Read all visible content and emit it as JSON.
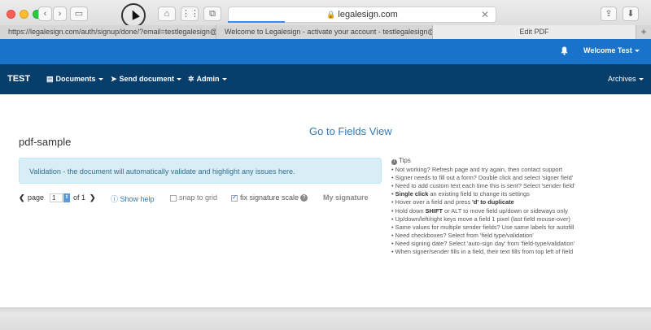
{
  "browser": {
    "url": "legalesign.com",
    "tabs": [
      {
        "label": "https://legalesign.com/auth/signup/done/?email=testlegalesign@gmail.com"
      },
      {
        "label": "Welcome to Legalesign - activate your account - testlegalesign@gma..."
      },
      {
        "label": "Edit PDF"
      }
    ],
    "new_tab": "+"
  },
  "topbar": {
    "welcome": "Welcome Test"
  },
  "nav": {
    "brand": "TEST",
    "documents": "Documents",
    "send_document": "Send document",
    "admin": "Admin",
    "archives": "Archives"
  },
  "main": {
    "fields_link": "Go to Fields View",
    "doc_title": "pdf-sample",
    "validation": "Validation - the document will automatically validate and highlight any issues here.",
    "page_label": "page",
    "page_value": "1",
    "of_label": "of 1",
    "show_help": "Show help",
    "snap_to_grid": "snap to grid",
    "fix_signature_scale": "fix signature scale",
    "my_signature": "My signature"
  },
  "tips": {
    "title": "Tips",
    "items": [
      {
        "pre": "• Not working? Refresh page and try again, then contact support",
        "bold": "",
        "post": ""
      },
      {
        "pre": "• Signer needs to fill out a form? Double click and select 'signer field'",
        "bold": "",
        "post": ""
      },
      {
        "pre": "• Need to add custom text each time this is sent? Select 'sender field'",
        "bold": "",
        "post": ""
      },
      {
        "pre": "• ",
        "bold": "Single click",
        "post": " an existing field to change its settings"
      },
      {
        "pre": "• Hover over a field and press ",
        "bold": "'d' to duplicate",
        "post": ""
      },
      {
        "pre": "• Hold down ",
        "bold": "SHIFT",
        "post": " or ALT to move field up/down or sideways only"
      },
      {
        "pre": "• Up/down/left/right keys move a field 1 pixel (last field mouse-over)",
        "bold": "",
        "post": ""
      },
      {
        "pre": "• Same values for multiple sender fields? Use same labels for autofill",
        "bold": "",
        "post": ""
      },
      {
        "pre": "• Need checkboxes? Select from 'field type/validation'",
        "bold": "",
        "post": ""
      },
      {
        "pre": "• Need signing date? Select 'auto-sign day' from 'field-type/validation'",
        "bold": "",
        "post": ""
      },
      {
        "pre": "• When signer/sender fills in a field, their text fills from top left of field",
        "bold": "",
        "post": ""
      }
    ]
  }
}
